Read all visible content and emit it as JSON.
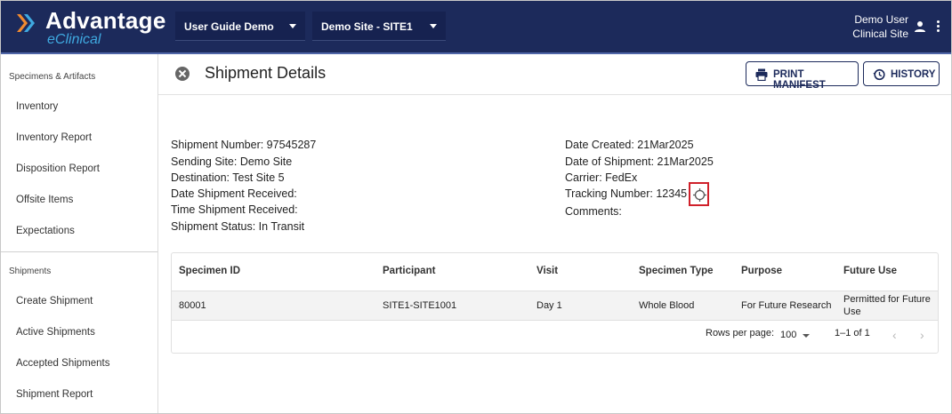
{
  "app": {
    "logo_title": "Advantage",
    "logo_subtitle": "eClinical",
    "study_select": "User Guide Demo",
    "site_select": "Demo Site - SITE1",
    "user_name": "Demo User",
    "user_role": "Clinical Site"
  },
  "sidebar": {
    "section1": "Specimens & Artifacts",
    "items1": [
      "Inventory",
      "Inventory Report",
      "Disposition Report",
      "Offsite Items",
      "Expectations"
    ],
    "section2": "Shipments",
    "items2": [
      "Create Shipment",
      "Active Shipments",
      "Accepted Shipments",
      "Shipment Report"
    ]
  },
  "page": {
    "title": "Shipment Details",
    "print_label": "PRINT MANIFEST",
    "history_label": "HISTORY"
  },
  "details": {
    "left": [
      "Shipment Number: 97545287",
      "Sending Site: Demo Site",
      "Destination: Test Site 5",
      "Date Shipment Received:",
      "Time Shipment Received:",
      "Shipment Status: In Transit"
    ],
    "right": [
      "Date Created: 21Mar2025",
      "Date of Shipment: 21Mar2025",
      "Carrier: FedEx",
      "Tracking Number: 12345",
      "Comments:"
    ]
  },
  "table": {
    "columns": [
      "Specimen ID",
      "Participant",
      "Visit",
      "Specimen Type",
      "Purpose",
      "Future Use"
    ],
    "rows": [
      [
        "80001",
        "SITE1-SITE1001",
        "Day 1",
        "Whole Blood",
        "For Future Research",
        "Permitted for Future Use"
      ]
    ],
    "rows_per_page_label": "Rows per page:",
    "rows_per_page_value": "100",
    "range_label": "1–1 of 1"
  },
  "colors": {
    "topbar": "#1c2a5b",
    "logo_accent": "#3fa9e0",
    "highlight_box": "#d0202a"
  },
  "icons": [
    "logo-chevron-icon",
    "person-icon",
    "more-vert-icon",
    "close-icon",
    "print-icon",
    "history-icon",
    "crosshair-track-icon",
    "chevron-left-icon",
    "chevron-right-icon"
  ]
}
